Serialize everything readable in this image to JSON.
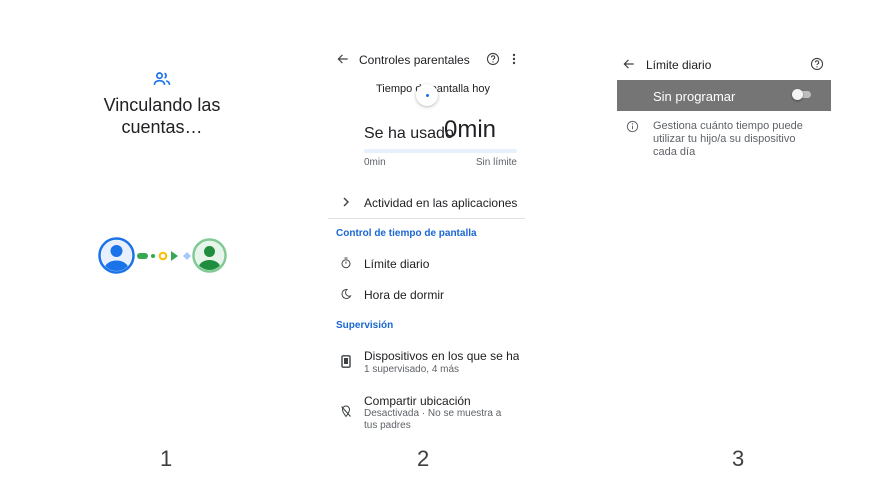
{
  "panel1": {
    "icon": "link-accounts-icon",
    "title": "Vinculando las cuentas…",
    "step": "1"
  },
  "panel2": {
    "header": {
      "title": "Controles parentales"
    },
    "today_label": "Tiempo de pantalla hoy",
    "used_label": "Se ha usado",
    "used_value": "0min",
    "bar": {
      "min_label": "0min",
      "max_label": "Sin límite"
    },
    "activity": {
      "label": "Actividad en las aplicaciones"
    },
    "section_screen_time": {
      "title": "Control de tiempo de pantalla",
      "items": [
        {
          "label": "Límite diario",
          "icon": "timer-icon"
        },
        {
          "label": "Hora de dormir",
          "icon": "moon-icon"
        }
      ]
    },
    "section_supervision": {
      "title": "Supervisión",
      "items": [
        {
          "label": "Dispositivos en los que se ha..",
          "sub": "1 supervisado, 4 más",
          "icon": "phone-icon"
        },
        {
          "label": "Compartir ubicación",
          "sub": "Desactivada · No se muestra a tus padres",
          "icon": "location-off-icon"
        }
      ]
    },
    "step": "2"
  },
  "panel3": {
    "header": {
      "title": "Límite diario"
    },
    "schedule_label": "Sin programar",
    "toggle_on": false,
    "description": "Gestiona cuánto tiempo puede utilizar tu hijo/a su dispositivo cada día",
    "step": "3"
  },
  "colors": {
    "accent_blue": "#1a73e8",
    "green": "#34a853",
    "yellow": "#fbbc04",
    "section_blue": "#1967d2",
    "bar_gray": "#757575"
  }
}
